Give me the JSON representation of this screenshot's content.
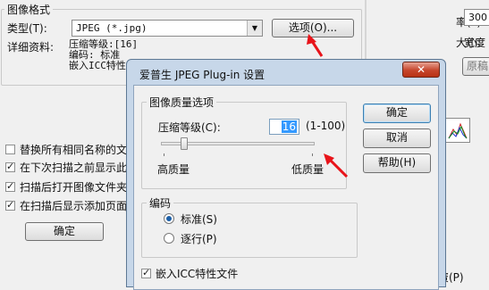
{
  "bg": {
    "format_group": "图像格式",
    "type_label": "类型(T):",
    "type_value": "JPEG (*.jpg)",
    "options_button": "选项(O)...",
    "details_label": "详细资料:",
    "details_lines": [
      "压缩等级:[16]",
      "编码: 标准",
      "嵌入ICC特性文"
    ],
    "checkboxes": [
      {
        "label": "替换所有相同名称的文件",
        "checked": false
      },
      {
        "label": "在下次扫描之前显示此对",
        "checked": true
      },
      {
        "label": "扫描后打开图像文件夹 (",
        "checked": true
      },
      {
        "label": "在扫描后显示添加页面对",
        "checked": true
      }
    ],
    "ok_button": "确定",
    "right_labels": [
      "率(L):",
      "大小:",
      "宽度",
      "原稿"
    ],
    "right_value": "300",
    "bottom_right": "资(P)"
  },
  "dialog": {
    "title": "爱普生 JPEG Plug-in 设置",
    "close_icon": "close-icon",
    "quality_group": "图像质量选项",
    "compression_label": "压缩等级(C):",
    "compression_value": "16",
    "range": "(1-100)",
    "slider_value": 16,
    "high_quality": "高质量",
    "low_quality": "低质量",
    "encoding_group": "编码",
    "radio_standard": "标准(S)",
    "radio_progressive": "逐行(P)",
    "encoding_selected": "standard",
    "embed_icc": "嵌入ICC特性文件",
    "embed_checked": true,
    "btn_ok": "确定",
    "btn_cancel": "取消",
    "btn_help": "帮助(H)"
  },
  "colors": {
    "annotation_arrow": "#e8141a",
    "title_bar": "#c7d7e9",
    "close_button": "#c6462c"
  }
}
